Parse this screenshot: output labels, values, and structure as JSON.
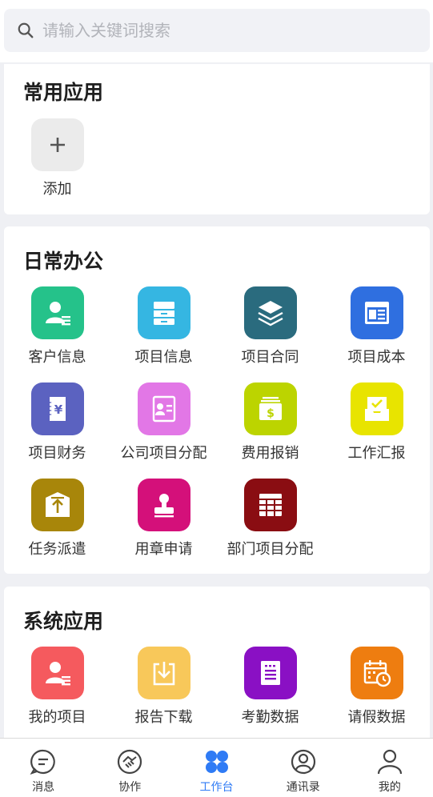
{
  "search": {
    "placeholder": "请输入关键词搜索"
  },
  "common": {
    "title": "常用应用",
    "add_label": "添加"
  },
  "daily": {
    "title": "日常办公",
    "items": [
      {
        "label": "客户信息",
        "color": "#25c28a",
        "icon": "customer-icon"
      },
      {
        "label": "项目信息",
        "color": "#35b6e2",
        "icon": "archive-icon"
      },
      {
        "label": "项目合同",
        "color": "#2a6b7e",
        "icon": "layers-icon"
      },
      {
        "label": "项目成本",
        "color": "#2f6fe0",
        "icon": "browser-icon"
      },
      {
        "label": "项目财务",
        "color": "#5b62c0",
        "icon": "yen-receipt-icon"
      },
      {
        "label": "公司项目分配",
        "color": "#e277e6",
        "icon": "contact-card-icon"
      },
      {
        "label": "费用报销",
        "color": "#bcd400",
        "icon": "money-stack-icon"
      },
      {
        "label": "工作汇报",
        "color": "#e8e400",
        "icon": "inbox-check-icon"
      },
      {
        "label": "任务派遣",
        "color": "#a8860a",
        "icon": "box-upload-icon"
      },
      {
        "label": "用章申请",
        "color": "#d4107a",
        "icon": "stamp-icon"
      },
      {
        "label": "部门项目分配",
        "color": "#8a0d12",
        "icon": "grid-table-icon"
      }
    ]
  },
  "system": {
    "title": "系统应用",
    "items": [
      {
        "label": "我的项目",
        "color": "#f55a5e",
        "icon": "user-project-icon"
      },
      {
        "label": "报告下载",
        "color": "#f8c85a",
        "icon": "download-icon"
      },
      {
        "label": "考勤数据",
        "color": "#8a10c4",
        "icon": "document-icon"
      },
      {
        "label": "请假数据",
        "color": "#ee7d10",
        "icon": "calendar-clock-icon"
      }
    ]
  },
  "tabbar": {
    "items": [
      {
        "label": "消息",
        "icon": "message-icon",
        "active": false
      },
      {
        "label": "协作",
        "icon": "handshake-icon",
        "active": false
      },
      {
        "label": "工作台",
        "icon": "workbench-icon",
        "active": true
      },
      {
        "label": "通讯录",
        "icon": "contacts-icon",
        "active": false
      },
      {
        "label": "我的",
        "icon": "profile-icon",
        "active": false
      }
    ],
    "active_color": "#2f7bf5"
  }
}
